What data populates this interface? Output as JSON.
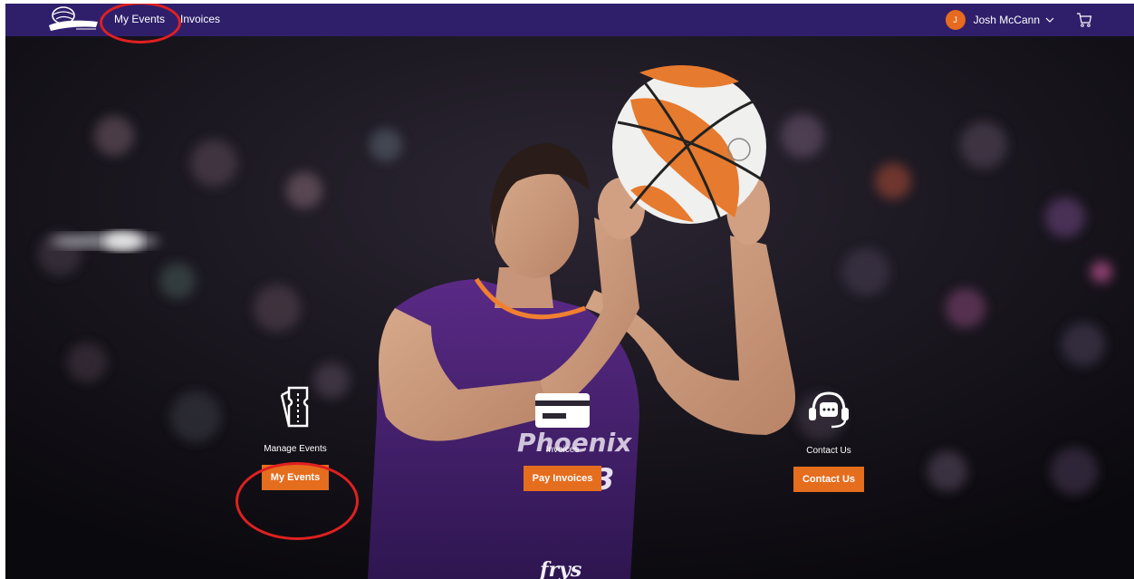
{
  "brand": {
    "logo": "phoenix-mercury-logo"
  },
  "nav": {
    "my_events": "My Events",
    "invoices": "Invoices",
    "user_initial": "J",
    "user_name": "Josh McCann",
    "cart_icon": "shopping-cart-icon"
  },
  "tiles": [
    {
      "icon": "ticket-icon",
      "caption": "Manage Events",
      "button": "My Events"
    },
    {
      "icon": "credit-card-icon",
      "caption": "Invoices",
      "button": "Pay Invoices"
    },
    {
      "icon": "headset-chat-icon",
      "caption": "Contact Us",
      "button": "Contact Us"
    }
  ],
  "hero": {
    "jersey_text": "Phoenix",
    "jersey_number": "3",
    "sponsor_text": "frys"
  },
  "colors": {
    "navbar": "#2f1f6b",
    "accent": "#e56d1e",
    "annotation": "#e02020"
  }
}
